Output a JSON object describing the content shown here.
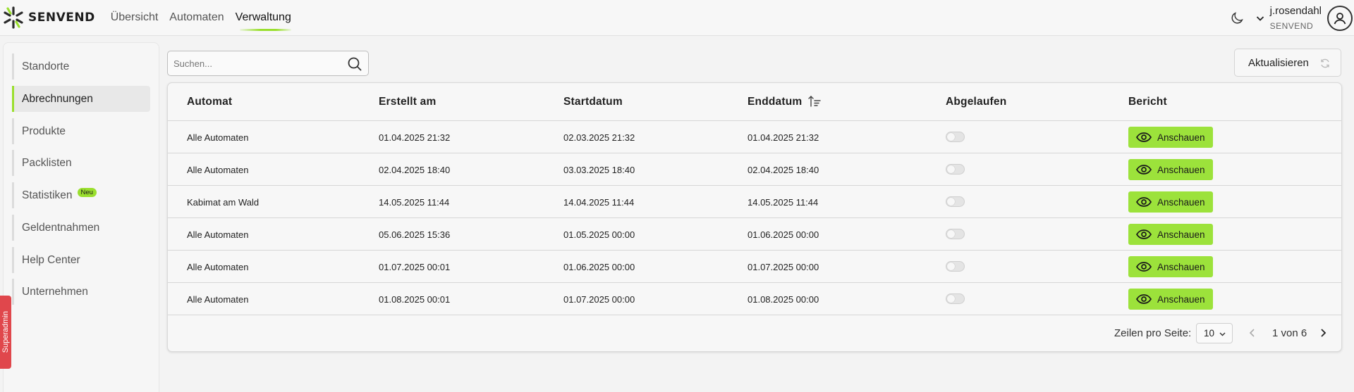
{
  "brand": {
    "name": "SENVEND",
    "accent": "#9adf2e"
  },
  "nav": {
    "items": [
      "Übersicht",
      "Automaten",
      "Verwaltung"
    ],
    "active": "Verwaltung"
  },
  "user": {
    "name": "j.rosendahl",
    "company": "SENVEND"
  },
  "icons": {
    "theme": "moon-icon",
    "menu": "chevron-down-icon",
    "account": "user-icon",
    "search": "search-icon",
    "refresh": "refresh-icon",
    "view": "eye-icon",
    "sort": "sort-ascending-icon"
  },
  "sidebar": {
    "items": [
      {
        "label": "Standorte"
      },
      {
        "label": "Abrechnungen",
        "active": true
      },
      {
        "label": "Produkte"
      },
      {
        "label": "Packlisten"
      },
      {
        "label": "Statistiken",
        "badge": "Neu"
      },
      {
        "label": "Geldentnahmen"
      },
      {
        "label": "Help Center"
      },
      {
        "label": "Unternehmen"
      }
    ]
  },
  "feedback": {
    "label": "Superadmin"
  },
  "search": {
    "placeholder": "Suchen...",
    "value": ""
  },
  "toolbar": {
    "refresh_label": "Aktualisieren"
  },
  "table": {
    "columns": [
      "Automat",
      "Erstellt am",
      "Startdatum",
      "Enddatum",
      "Abgelaufen",
      "Bericht"
    ],
    "sort_column": "Enddatum",
    "rows": [
      {
        "automat": "Alle Automaten",
        "erstellt": "01.04.2025 21:32",
        "start": "02.03.2025 21:32",
        "end": "01.04.2025 21:32",
        "abgelaufen": false,
        "bericht": "Anschauen"
      },
      {
        "automat": "Alle Automaten",
        "erstellt": "02.04.2025 18:40",
        "start": "03.03.2025 18:40",
        "end": "02.04.2025 18:40",
        "abgelaufen": false,
        "bericht": "Anschauen"
      },
      {
        "automat": "Kabimat am Wald",
        "erstellt": "14.05.2025 11:44",
        "start": "14.04.2025 11:44",
        "end": "14.05.2025 11:44",
        "abgelaufen": false,
        "bericht": "Anschauen"
      },
      {
        "automat": "Alle Automaten",
        "erstellt": "05.06.2025 15:36",
        "start": "01.05.2025 00:00",
        "end": "01.06.2025 00:00",
        "abgelaufen": false,
        "bericht": "Anschauen"
      },
      {
        "automat": "Alle Automaten",
        "erstellt": "01.07.2025 00:01",
        "start": "01.06.2025 00:00",
        "end": "01.07.2025 00:00",
        "abgelaufen": false,
        "bericht": "Anschauen"
      },
      {
        "automat": "Alle Automaten",
        "erstellt": "01.08.2025 00:01",
        "start": "01.07.2025 00:00",
        "end": "01.08.2025 00:00",
        "abgelaufen": false,
        "bericht": "Anschauen"
      }
    ]
  },
  "pagination": {
    "rows_per_page_label": "Zeilen pro Seite:",
    "rows_per_page": "10",
    "page_info": "1 von 6"
  }
}
